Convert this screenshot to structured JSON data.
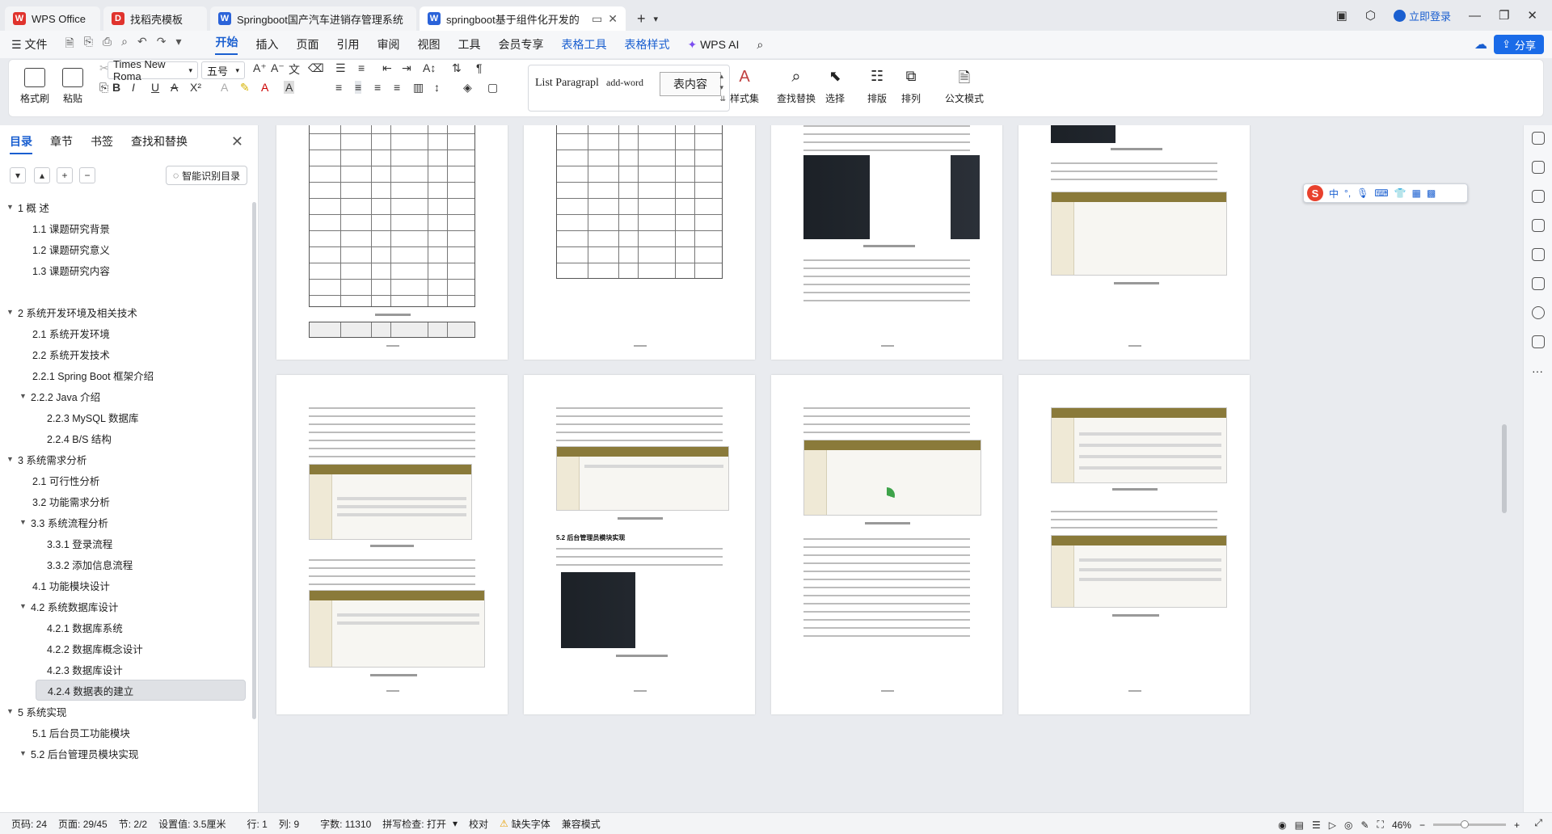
{
  "tabs": [
    {
      "label": "WPS Office",
      "icon": "wps-logo-icon",
      "color": "#e0332d"
    },
    {
      "label": "找稻壳模板",
      "icon": "docer-icon",
      "color": "#e0332d"
    },
    {
      "label": "Springboot国产汽车进销存管理系统",
      "icon": "word-doc-icon",
      "color": "#2b63d9"
    },
    {
      "label": "springboot基于组件化开发的",
      "icon": "word-doc-icon",
      "color": "#2b63d9"
    }
  ],
  "window": {
    "login_label": "立即登录",
    "share_label": "分享"
  },
  "menu": {
    "file_label": "文件",
    "items": [
      "开始",
      "插入",
      "页面",
      "引用",
      "审阅",
      "视图",
      "工具",
      "会员专享",
      "表格工具",
      "表格样式"
    ],
    "ai_label": "WPS AI"
  },
  "ribbon": {
    "format_painter": "格式刷",
    "paste": "粘贴",
    "font_name": "Times New Roma",
    "font_size": "五号",
    "styles": [
      "List Paragrapl",
      "add-word",
      "表内容"
    ],
    "style_set": "样式集",
    "find_replace": "查找替换",
    "select": "选择",
    "layout": "排版",
    "arrange": "排列",
    "official_mode": "公文模式"
  },
  "nav_panel": {
    "tabs": [
      "目录",
      "章节",
      "书签",
      "查找和替换"
    ],
    "smart_toc_label": "智能识别目录",
    "toc": [
      {
        "label": "1 概 述",
        "level": 1,
        "expanded": true
      },
      {
        "label": "1.1 课题研究背景",
        "level": 2
      },
      {
        "label": "1.2 课题研究意义",
        "level": 2
      },
      {
        "label": "1.3 课题研究内容",
        "level": 2
      },
      {
        "label": "",
        "level": 0
      },
      {
        "label": "2 系统开发环境及相关技术",
        "level": 1,
        "expanded": true
      },
      {
        "label": "2.1 系统开发环境",
        "level": 2
      },
      {
        "label": "2.2 系统开发技术",
        "level": 2
      },
      {
        "label": "2.2.1 Spring Boot 框架介绍",
        "level": 2
      },
      {
        "label": "2.2.2 Java 介绍",
        "level": 2,
        "expanded": true
      },
      {
        "label": "2.2.3 MySQL 数据库",
        "level": 3
      },
      {
        "label": "2.2.4 B/S 结构",
        "level": 3
      },
      {
        "label": "3 系统需求分析",
        "level": 1,
        "expanded": true
      },
      {
        "label": "2.1 可行性分析",
        "level": 2
      },
      {
        "label": "3.2 功能需求分析",
        "level": 2
      },
      {
        "label": "3.3 系统流程分析",
        "level": 2,
        "expanded": true
      },
      {
        "label": "3.3.1 登录流程",
        "level": 3
      },
      {
        "label": "3.3.2 添加信息流程",
        "level": 3
      },
      {
        "label": "4.1 功能模块设计",
        "level": 2
      },
      {
        "label": "4.2 系统数据库设计",
        "level": 2,
        "expanded": true
      },
      {
        "label": "4.2.1 数据库系统",
        "level": 3
      },
      {
        "label": "4.2.2 数据库概念设计",
        "level": 3
      },
      {
        "label": "4.2.3 数据库设计",
        "level": 3
      },
      {
        "label": "4.2.4 数据表的建立",
        "level": 3,
        "selected": true
      },
      {
        "label": "",
        "level": 0
      },
      {
        "label": "5 系统实现",
        "level": 1,
        "expanded": true
      },
      {
        "label": "5.1 后台员工功能模块",
        "level": 2
      },
      {
        "label": "5.2 后台管理员模块实现",
        "level": 2,
        "expanded": true
      }
    ]
  },
  "document": {
    "heading_52": "5.2 后台管理员模块实现"
  },
  "status": {
    "page_code": "页码: 24",
    "page": "页面: 29/45",
    "section": "节: 2/2",
    "setting": "设置值: 3.5厘米",
    "row": "行: 1",
    "col": "列: 9",
    "words": "字数: 11310",
    "spell": "拼写检查: 打开",
    "proof": "校对",
    "missing_font": "缺失字体",
    "compat": "兼容模式",
    "zoom": "46%"
  },
  "colors": {
    "accent": "#1a5fd0",
    "share_btn": "#1a6be8"
  }
}
